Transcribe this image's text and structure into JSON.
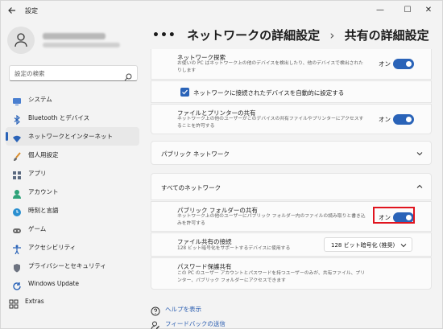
{
  "window": {
    "title": "設定",
    "minimize": "—",
    "maximize": "☐",
    "close": "✕"
  },
  "sidebar": {
    "search_placeholder": "設定の検索",
    "items": [
      {
        "label": "システム",
        "icon": "monitor-icon"
      },
      {
        "label": "Bluetooth とデバイス",
        "icon": "bluetooth-icon"
      },
      {
        "label": "ネットワークとインターネット",
        "icon": "wifi-icon",
        "active": true
      },
      {
        "label": "個人用設定",
        "icon": "brush-icon"
      },
      {
        "label": "アプリ",
        "icon": "apps-icon"
      },
      {
        "label": "アカウント",
        "icon": "person-icon"
      },
      {
        "label": "時刻と言語",
        "icon": "globe-clock-icon"
      },
      {
        "label": "ゲーム",
        "icon": "gamepad-icon"
      },
      {
        "label": "アクセシビリティ",
        "icon": "accessibility-icon"
      },
      {
        "label": "プライバシーとセキュリティ",
        "icon": "shield-icon"
      },
      {
        "label": "Windows Update",
        "icon": "update-icon"
      }
    ],
    "extras": "Extras"
  },
  "breadcrumb": {
    "dots": "•••",
    "parent": "ネットワークの詳細設定",
    "sep": "›",
    "current": "共有の詳細設定"
  },
  "private_section": {
    "discovery_title": "ネットワーク探索",
    "discovery_desc": "お使いの PC はネットワーク上の他のデバイスを検出したり、他のデバイスで検出されたりします",
    "discovery_state": "オン",
    "auto_setup_label": "ネットワークに接続されたデバイスを自動的に設定する",
    "file_share_title": "ファイルとプリンターの共有",
    "file_share_desc": "ネットワーク上の他のユーザーがこのデバイスの共有ファイルやプリンターにアクセスすることを許可する",
    "file_share_state": "オン"
  },
  "public_section": {
    "title": "パブリック ネットワーク"
  },
  "all_section": {
    "title": "すべてのネットワーク",
    "public_folder_title": "パブリック フォルダーの共有",
    "public_folder_desc": "ネットワーク上の他のユーザーにパブリック フォルダー内のファイルの読み取りと書き込みを許可する",
    "public_folder_state": "オン",
    "file_conn_title": "ファイル共有の接続",
    "file_conn_desc": "128 ビット暗号化をサポートするデバイスに使用する",
    "file_conn_value": "128 ビット暗号化 (推奨)",
    "password_title": "パスワード保護共有",
    "password_desc": "この PC のユーザー アカウントとパスワードを持つユーザーのみが、共有ファイル、プリンター、パブリック フォルダーにアクセスできます"
  },
  "footer": {
    "help": "ヘルプを表示",
    "feedback": "フィードバックの送信"
  },
  "colors": {
    "accent": "#2a63b8",
    "highlight": "#e0141e"
  }
}
